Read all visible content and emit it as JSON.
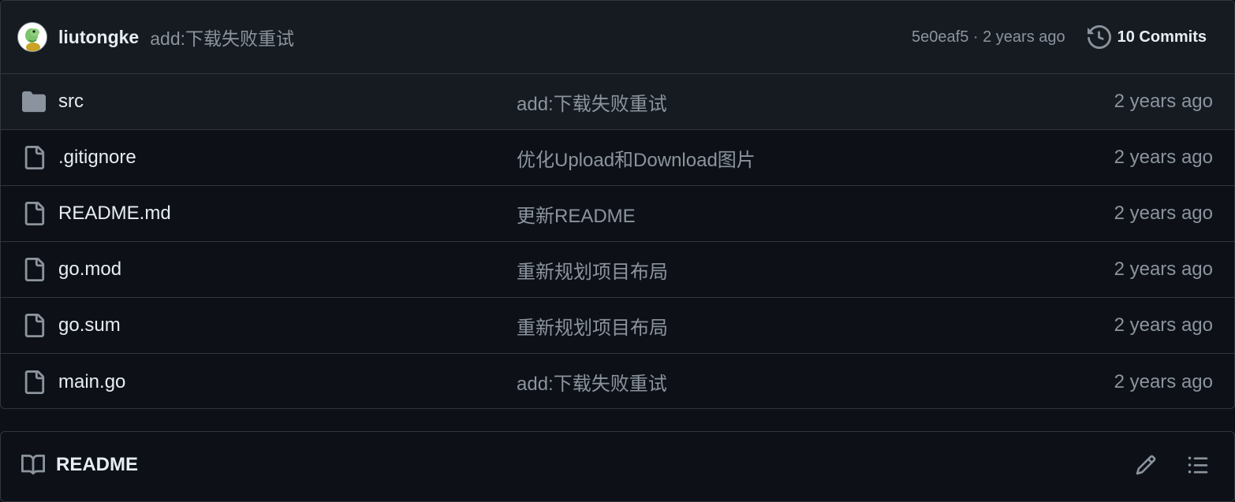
{
  "latest_commit": {
    "author": "liutongke",
    "message": "add:下载失败重试",
    "sha": "5e0eaf5",
    "separator": "·",
    "age": "2 years ago",
    "commits_label": "10 Commits"
  },
  "files": [
    {
      "name": "src",
      "type": "folder",
      "commit": "add:下载失败重试",
      "age": "2 years ago"
    },
    {
      "name": ".gitignore",
      "type": "file",
      "commit": "优化Upload和Download图片",
      "age": "2 years ago"
    },
    {
      "name": "README.md",
      "type": "file",
      "commit": "更新README",
      "age": "2 years ago"
    },
    {
      "name": "go.mod",
      "type": "file",
      "commit": "重新规划项目布局",
      "age": "2 years ago"
    },
    {
      "name": "go.sum",
      "type": "file",
      "commit": "重新规划项目布局",
      "age": "2 years ago"
    },
    {
      "name": "main.go",
      "type": "file",
      "commit": "add:下载失败重试",
      "age": "2 years ago"
    }
  ],
  "readme": {
    "title": "README"
  },
  "icons": {
    "avatar": "avatar-image",
    "history": "history-icon",
    "folder": "folder-icon",
    "file": "file-icon",
    "book": "book-icon",
    "edit": "pencil-icon",
    "outline": "list-icon"
  },
  "colors": {
    "background": "#0d1117",
    "header_bg": "#161b22",
    "border": "#30363d",
    "text": "#e6edf3",
    "muted": "#8b949e"
  }
}
